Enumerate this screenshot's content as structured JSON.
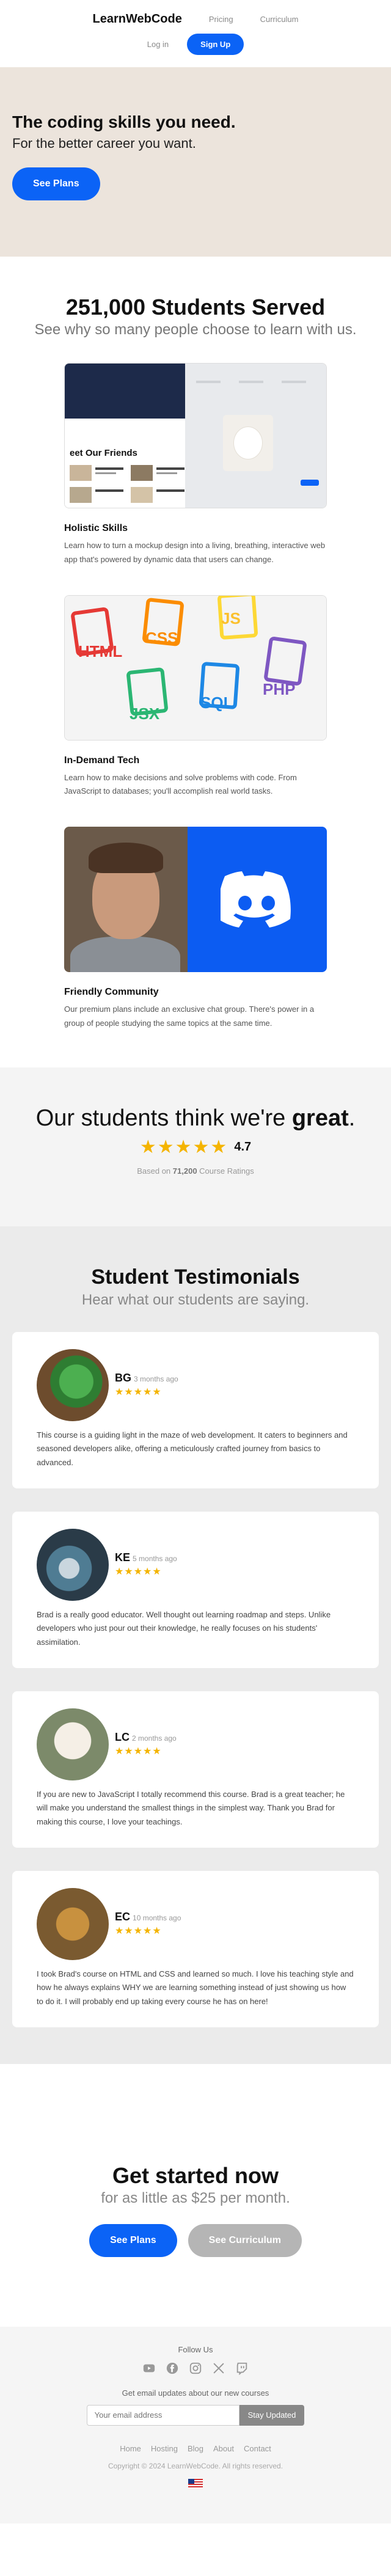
{
  "nav": {
    "logo": "LearnWebCode",
    "pricing": "Pricing",
    "curriculum": "Curriculum",
    "login": "Log in",
    "signup": "Sign Up"
  },
  "hero": {
    "title": "The coding skills you need.",
    "subtitle": "For the better career you want.",
    "cta": "See Plans"
  },
  "served": {
    "title": "251,000 Students Served",
    "subtitle": "See why so many people choose to learn with us.",
    "features": [
      {
        "title": "Holistic Skills",
        "text": "Learn how to turn a mockup design into a living, breathing, interactive web app that's powered by dynamic data that users can change.",
        "image_text": "eet Our Friends"
      },
      {
        "title": "In-Demand Tech",
        "text": "Learn how to make decisions and solve problems with code. From JavaScript to databases; you'll accomplish real world tasks.",
        "langs": [
          "HTML",
          "CSS",
          "JS",
          "JSX",
          "SQL",
          "PHP"
        ]
      },
      {
        "title": "Friendly Community",
        "text": "Our premium plans include an exclusive chat group. There's power in a group of people studying the same topics at the same time."
      }
    ]
  },
  "rating": {
    "title_prefix": "Our students think we're",
    "title_emphasis": "great",
    "title_suffix": ".",
    "stars": "★★★★★",
    "value": "4.7",
    "note_prefix": "Based on",
    "note_count": "71,200",
    "note_suffix": "Course Ratings"
  },
  "testimonials": {
    "title": "Student Testimonials",
    "subtitle": "Hear what our students are saying.",
    "items": [
      {
        "initials": "BG",
        "ago": "3 months ago",
        "stars": "★★★★★",
        "text": "This course is a guiding light in the maze of web development. It caters to beginners and seasoned developers alike, offering a meticulously crafted journey from basics to advanced."
      },
      {
        "initials": "KE",
        "ago": "5 months ago",
        "stars": "★★★★★",
        "text": "Brad is a really good educator. Well thought out learning roadmap and steps. Unlike developers who just pour out their knowledge, he really focuses on his students' assimilation."
      },
      {
        "initials": "LC",
        "ago": "2 months ago",
        "stars": "★★★★★",
        "text": "If you are new to JavaScript I totally recommend this course. Brad is a great teacher; he will make you understand the smallest things in the simplest way. Thank you Brad for making this course, I love your teachings."
      },
      {
        "initials": "EC",
        "ago": "10 months ago",
        "stars": "★★★★★",
        "text": "I took Brad's course on HTML and CSS and learned so much. I love his teaching style and how he always explains WHY we are learning something instead of just showing us how to do it. I will probably end up taking every course he has on here!"
      }
    ]
  },
  "cta": {
    "title": "Get started now",
    "subtitle": "for as little as $25 per month.",
    "plans": "See Plans",
    "curriculum": "See Curriculum"
  },
  "footer": {
    "follow": "Follow Us",
    "social_icons": [
      "youtube-icon",
      "facebook-icon",
      "instagram-icon",
      "x-icon",
      "twitch-icon"
    ],
    "email_label": "Get email updates about our new courses",
    "email_placeholder": "Your email address",
    "stay_updated": "Stay Updated",
    "links": [
      "Home",
      "Hosting",
      "Blog",
      "About",
      "Contact"
    ],
    "copyright": "Copyright © 2024 LearnWebCode. All rights reserved."
  },
  "colors": {
    "accent": "#0b63f6",
    "hero_bg": "#ece4dc",
    "star": "#f4b400",
    "discord": "#0c5cf2"
  }
}
